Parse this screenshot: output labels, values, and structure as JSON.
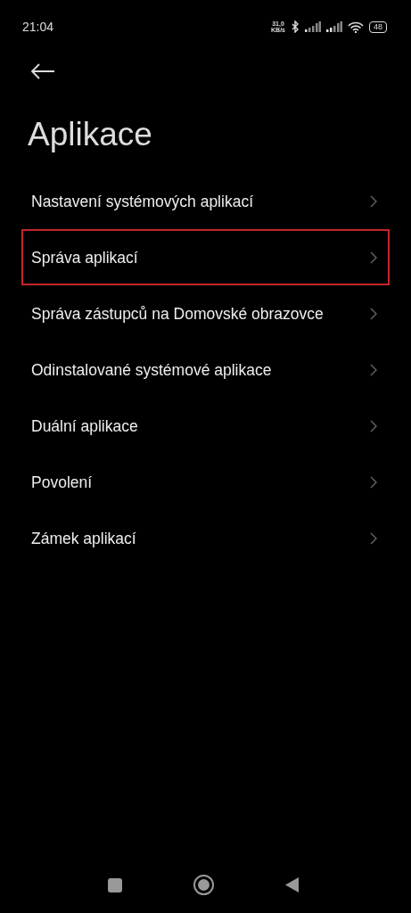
{
  "status_bar": {
    "time": "21:04",
    "speed_value": "31,0",
    "speed_unit": "KB/s",
    "battery": "48"
  },
  "header": {
    "title": "Aplikace"
  },
  "items": [
    {
      "label": "Nastavení systémových aplikací",
      "highlighted": false
    },
    {
      "label": "Správa aplikací",
      "highlighted": true
    },
    {
      "label": "Správa zástupců na Domovské obrazovce",
      "highlighted": false
    },
    {
      "label": "Odinstalované systémové aplikace",
      "highlighted": false
    },
    {
      "label": "Duální aplikace",
      "highlighted": false
    },
    {
      "label": "Povolení",
      "highlighted": false
    },
    {
      "label": "Zámek aplikací",
      "highlighted": false
    }
  ]
}
